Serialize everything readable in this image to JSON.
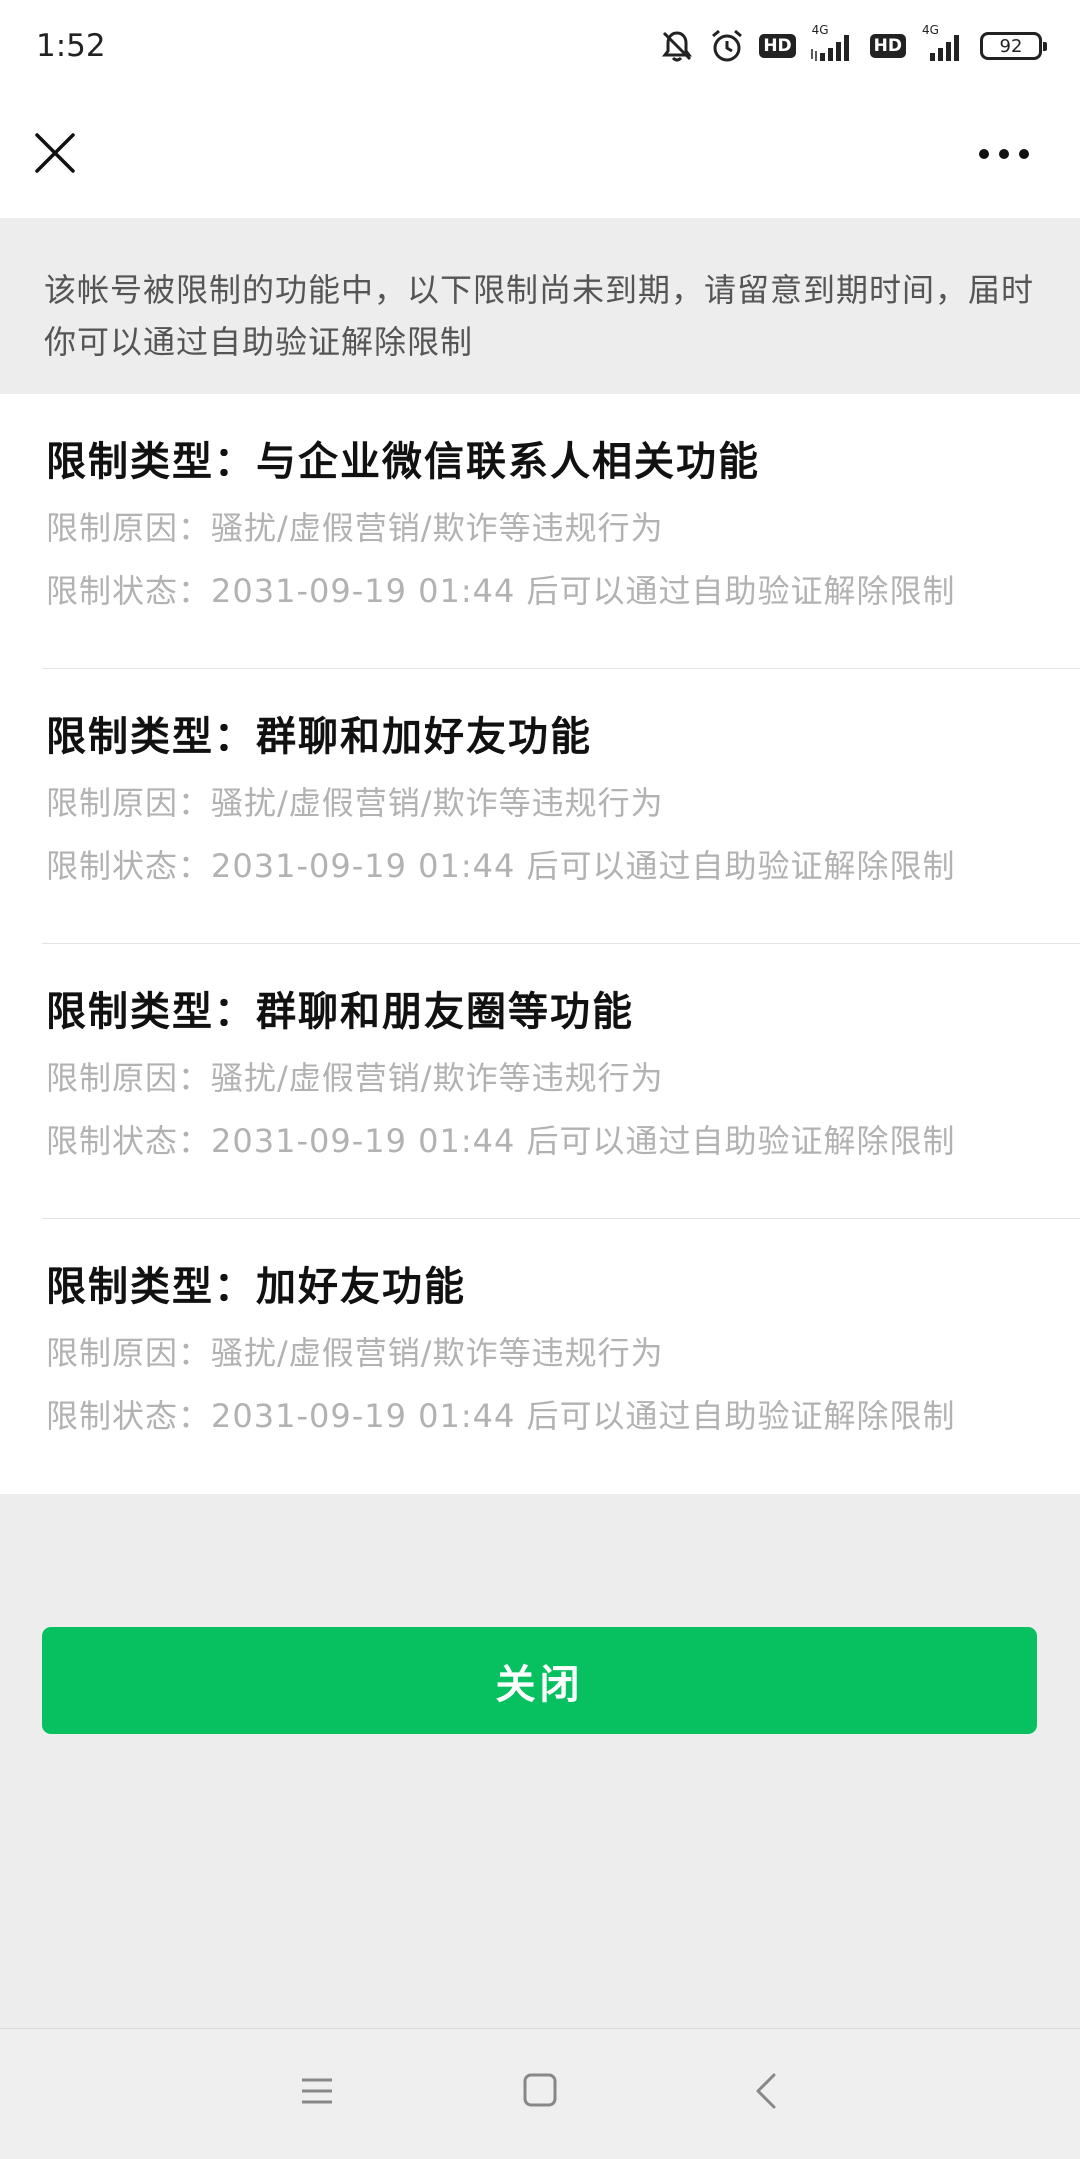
{
  "status_bar": {
    "time": "1:52",
    "net_type_1": "4G",
    "net_type_2": "4G",
    "hd_label_1": "HD",
    "hd_label_2": "HD",
    "battery": "92",
    "icons": [
      "mute-bell-icon",
      "alarm-clock-icon",
      "signal-icon",
      "battery-icon"
    ]
  },
  "header": {
    "close_icon": "close-icon",
    "more_icon": "more-icon"
  },
  "notice": {
    "text": "该帐号被限制的功能中，以下限制尚未到期，请留意到期时间，届时你可以通过自助验证解除限制"
  },
  "restrictions": [
    {
      "type": "限制类型：与企业微信联系人相关功能",
      "reason": "限制原因：骚扰/虚假营销/欺诈等违规行为",
      "status": "限制状态：2031-09-19 01:44 后可以通过自助验证解除限制"
    },
    {
      "type": "限制类型：群聊和加好友功能",
      "reason": "限制原因：骚扰/虚假营销/欺诈等违规行为",
      "status": "限制状态：2031-09-19 01:44 后可以通过自助验证解除限制"
    },
    {
      "type": "限制类型：群聊和朋友圈等功能",
      "reason": "限制原因：骚扰/虚假营销/欺诈等违规行为",
      "status": "限制状态：2031-09-19 01:44 后可以通过自助验证解除限制"
    },
    {
      "type": "限制类型：加好友功能",
      "reason": "限制原因：骚扰/虚假营销/欺诈等违规行为",
      "status": "限制状态：2031-09-19 01:44 后可以通过自助验证解除限制"
    }
  ],
  "actions": {
    "close_label": "关闭"
  },
  "colors": {
    "accent": "#07c160",
    "background": "#ededed",
    "secondary_text": "#b2b2b2"
  },
  "system_nav": {
    "icons": [
      "menu-icon",
      "home-icon",
      "back-icon"
    ]
  }
}
